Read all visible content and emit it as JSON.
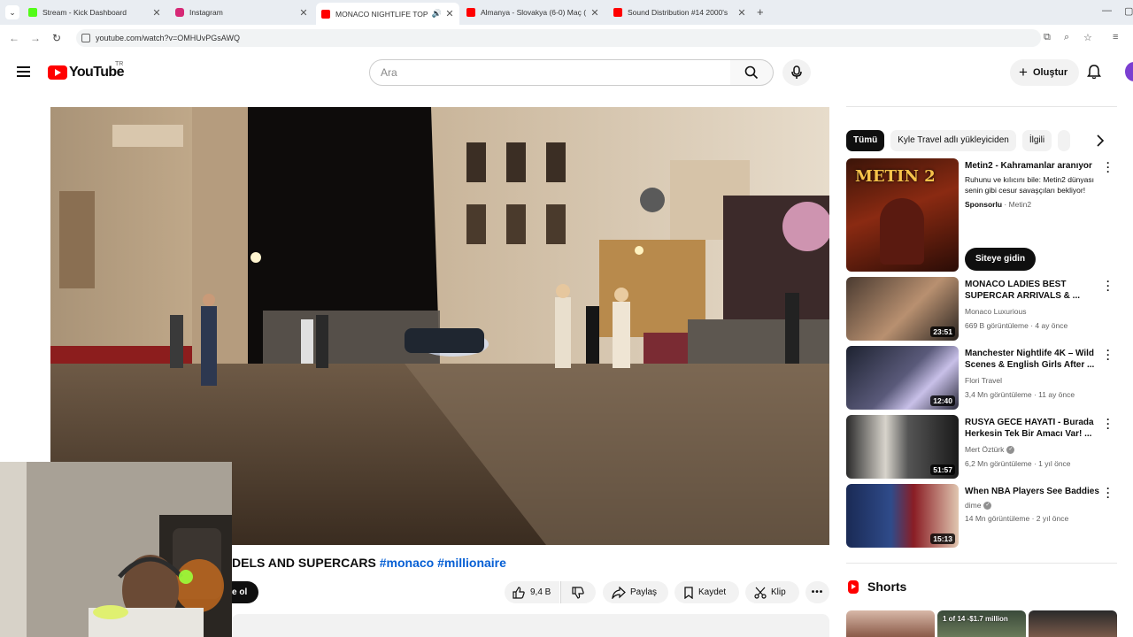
{
  "browser": {
    "tabs": [
      {
        "title": "Stream - Kick Dashboard",
        "favicon_color": "#53fc18"
      },
      {
        "title": "Instagram",
        "favicon_color": "#d62976"
      },
      {
        "title": "MONACO NIGHTLIFE TOP M",
        "favicon_color": "#ff0000"
      },
      {
        "title": "Almanya - Slovakya (6-0) Maç (",
        "favicon_color": "#ff0000"
      },
      {
        "title": "Sound Distribution #14 2000's",
        "favicon_color": "#ff0000"
      }
    ],
    "url": "youtube.com/watch?v=OMHUvPGsAWQ"
  },
  "header": {
    "logo_text": "YouTube",
    "country_code": "TR",
    "search_placeholder": "Ara",
    "create_label": "Oluştur"
  },
  "video": {
    "title_text": "DELS AND SUPERCARS",
    "hashtag_1": "#monaco",
    "hashtag_2": "#millionaire",
    "subscribe_label": "e ol",
    "like_count": "9,4 B",
    "share_label": "Paylaş",
    "save_label": "Kaydet",
    "clip_label": "Klip"
  },
  "sidebar": {
    "chips": [
      "Tümü",
      "Kyle Travel adlı yükleyiciden",
      "İlgili"
    ],
    "ad": {
      "title": "Metin2 - Kahramanlar aranıyor",
      "description": "Ruhunu ve kılıcını bile: Metin2 dünyası senin gibi cesur savaşçıları bekliyor!",
      "sponsor_label": "Sponsorlu",
      "advertiser": "Metin2",
      "cta": "Siteye gidin",
      "thumb_text": "METIN 2"
    },
    "videos": [
      {
        "title": "MONACO LADIES BEST SUPERCAR ARRIVALS & ...",
        "channel": "Monaco Luxurious",
        "verified": false,
        "meta": "669 B görüntüleme · 4 ay önce",
        "duration": "23:51"
      },
      {
        "title": "Manchester Nightlife 4K – Wild Scenes & English Girls After ...",
        "channel": "Flori Travel",
        "verified": false,
        "meta": "3,4 Mn görüntüleme · 11 ay önce",
        "duration": "12:40"
      },
      {
        "title": "RUSYA GECE HAYATI - Burada Herkesin Tek Bir Amacı Var! ...",
        "channel": "Mert Öztürk",
        "verified": true,
        "meta": "6,2 Mn görüntüleme · 1 yıl önce",
        "duration": "51:57"
      },
      {
        "title": "When NBA Players See Baddies",
        "channel": "dime",
        "verified": true,
        "meta": "14 Mn görüntüleme · 2 yıl önce",
        "duration": "15:13"
      }
    ],
    "shorts_label": "Shorts",
    "shorts": [
      {
        "label": ""
      },
      {
        "label": "1 of 14 -$1.7 million"
      },
      {
        "label": ""
      }
    ]
  },
  "colors": {
    "accent_red": "#ff0000",
    "link_blue": "#065fd4",
    "chip_bg": "#f2f2f2"
  }
}
